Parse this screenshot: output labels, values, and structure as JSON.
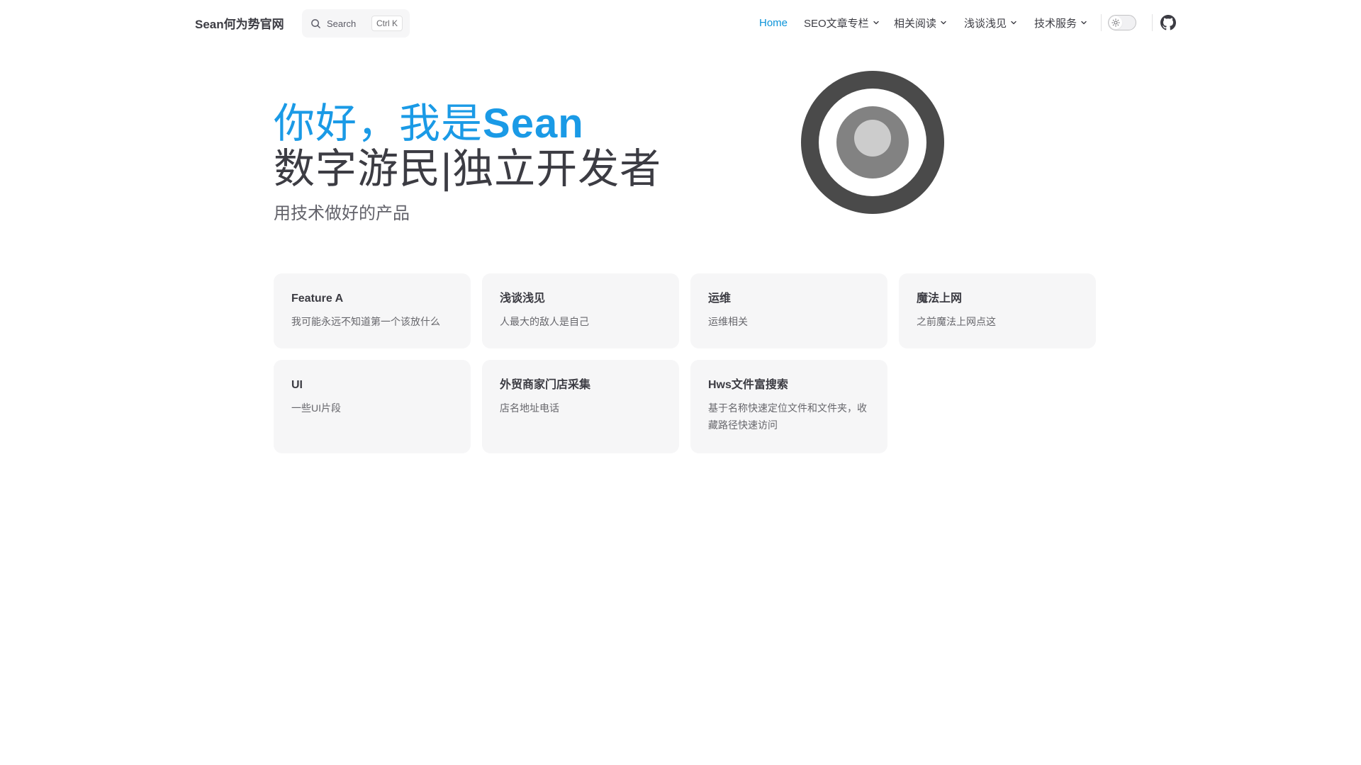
{
  "nav": {
    "site_title": "Sean何为势官网",
    "search": {
      "label": "Search",
      "shortcut": "Ctrl K"
    },
    "links": [
      {
        "label": "Home",
        "active": true,
        "dropdown": false
      },
      {
        "label": "SEO文章专栏",
        "active": false,
        "dropdown": true
      },
      {
        "label": "相关阅读",
        "active": false,
        "dropdown": true
      },
      {
        "label": "浅谈浅见",
        "active": false,
        "dropdown": true
      },
      {
        "label": "技术服务",
        "active": false,
        "dropdown": true
      }
    ],
    "icons": {
      "search": "search-icon",
      "chevron": "chevron-down-icon",
      "theme": "sun-icon",
      "github": "github-icon"
    }
  },
  "hero": {
    "name_prefix": "你好，我是",
    "name": "Sean",
    "text": "数字游民|独立开发者",
    "tagline": "用技术做好的产品",
    "image": "concentric-circles-logo"
  },
  "features": [
    {
      "title": "Feature A",
      "details": "我可能永远不知道第一个该放什么"
    },
    {
      "title": "浅谈浅见",
      "details": "人最大的敌人是自己"
    },
    {
      "title": "运维",
      "details": "运维相关"
    },
    {
      "title": "魔法上网",
      "details": "之前魔法上网点这"
    },
    {
      "title": "UI",
      "details": "一些UI片段"
    },
    {
      "title": "外贸商家门店采集",
      "details": "店名地址电话"
    },
    {
      "title": "Hws文件富搜索",
      "details": "基于名称快速定位文件和文件夹，收藏路径快速访问"
    }
  ],
  "colors": {
    "brand": "#1a9ae6",
    "text": "#3c3c43",
    "card_bg": "#f6f6f7",
    "logo_outer": "#4a4a4a",
    "logo_middle": "#828282",
    "logo_inner": "#cccccc"
  }
}
